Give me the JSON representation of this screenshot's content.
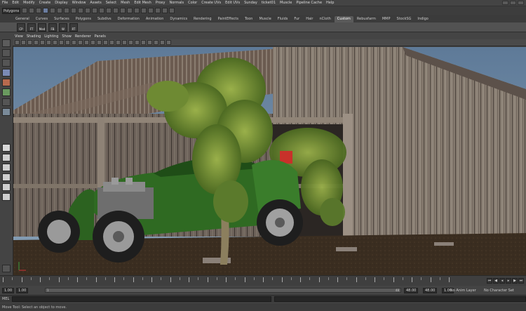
{
  "menubar": {
    "items": [
      "File",
      "Edit",
      "Modify",
      "Create",
      "Display",
      "Window",
      "Assets",
      "Select",
      "Mesh",
      "Edit Mesh",
      "Proxy",
      "Normals",
      "Color",
      "Create UVs",
      "Edit UVs",
      "Sunday",
      "ticket01",
      "Muscle",
      "Pipeline Cache",
      "Help"
    ]
  },
  "statusline": {
    "mode": "Polygons"
  },
  "shelf": {
    "tabs": [
      "General",
      "Curves",
      "Surfaces",
      "Polygons",
      "Subdivs",
      "Deformation",
      "Animation",
      "Dynamics",
      "Rendering",
      "PaintEffects",
      "Toon",
      "Muscle",
      "Fluids",
      "Fur",
      "Hair",
      "nCloth",
      "Custom",
      "Rebusfarm",
      "MMP",
      "StockSG",
      "Indigo"
    ],
    "active_tab": "Custom",
    "buttons": [
      "CP",
      "FT",
      "Med",
      "FB",
      "W",
      "RT"
    ]
  },
  "panel": {
    "menu": [
      "View",
      "Shading",
      "Lighting",
      "Show",
      "Renderer",
      "Panels"
    ]
  },
  "timeline": {
    "range_start": "1.00",
    "anim_start": "1.00",
    "range_slider_start": "1",
    "range_slider_end": "48",
    "range_end": "48.00",
    "anim_end": "48.00",
    "current_frame": "1.00",
    "anim_layer": "No Anim Layer",
    "character_set": "No Character Set",
    "playback": [
      "⏮",
      "◀",
      "◂",
      "▸",
      "▶",
      "⏭"
    ]
  },
  "command": {
    "label": "MEL"
  },
  "help": {
    "text": "Move Tool: Select an object to move."
  },
  "colors": {
    "background": "#444444",
    "viewport_sky": "#6e8aa8",
    "car_green": "#2f6a22",
    "barn_wood": "#8a7e73"
  }
}
